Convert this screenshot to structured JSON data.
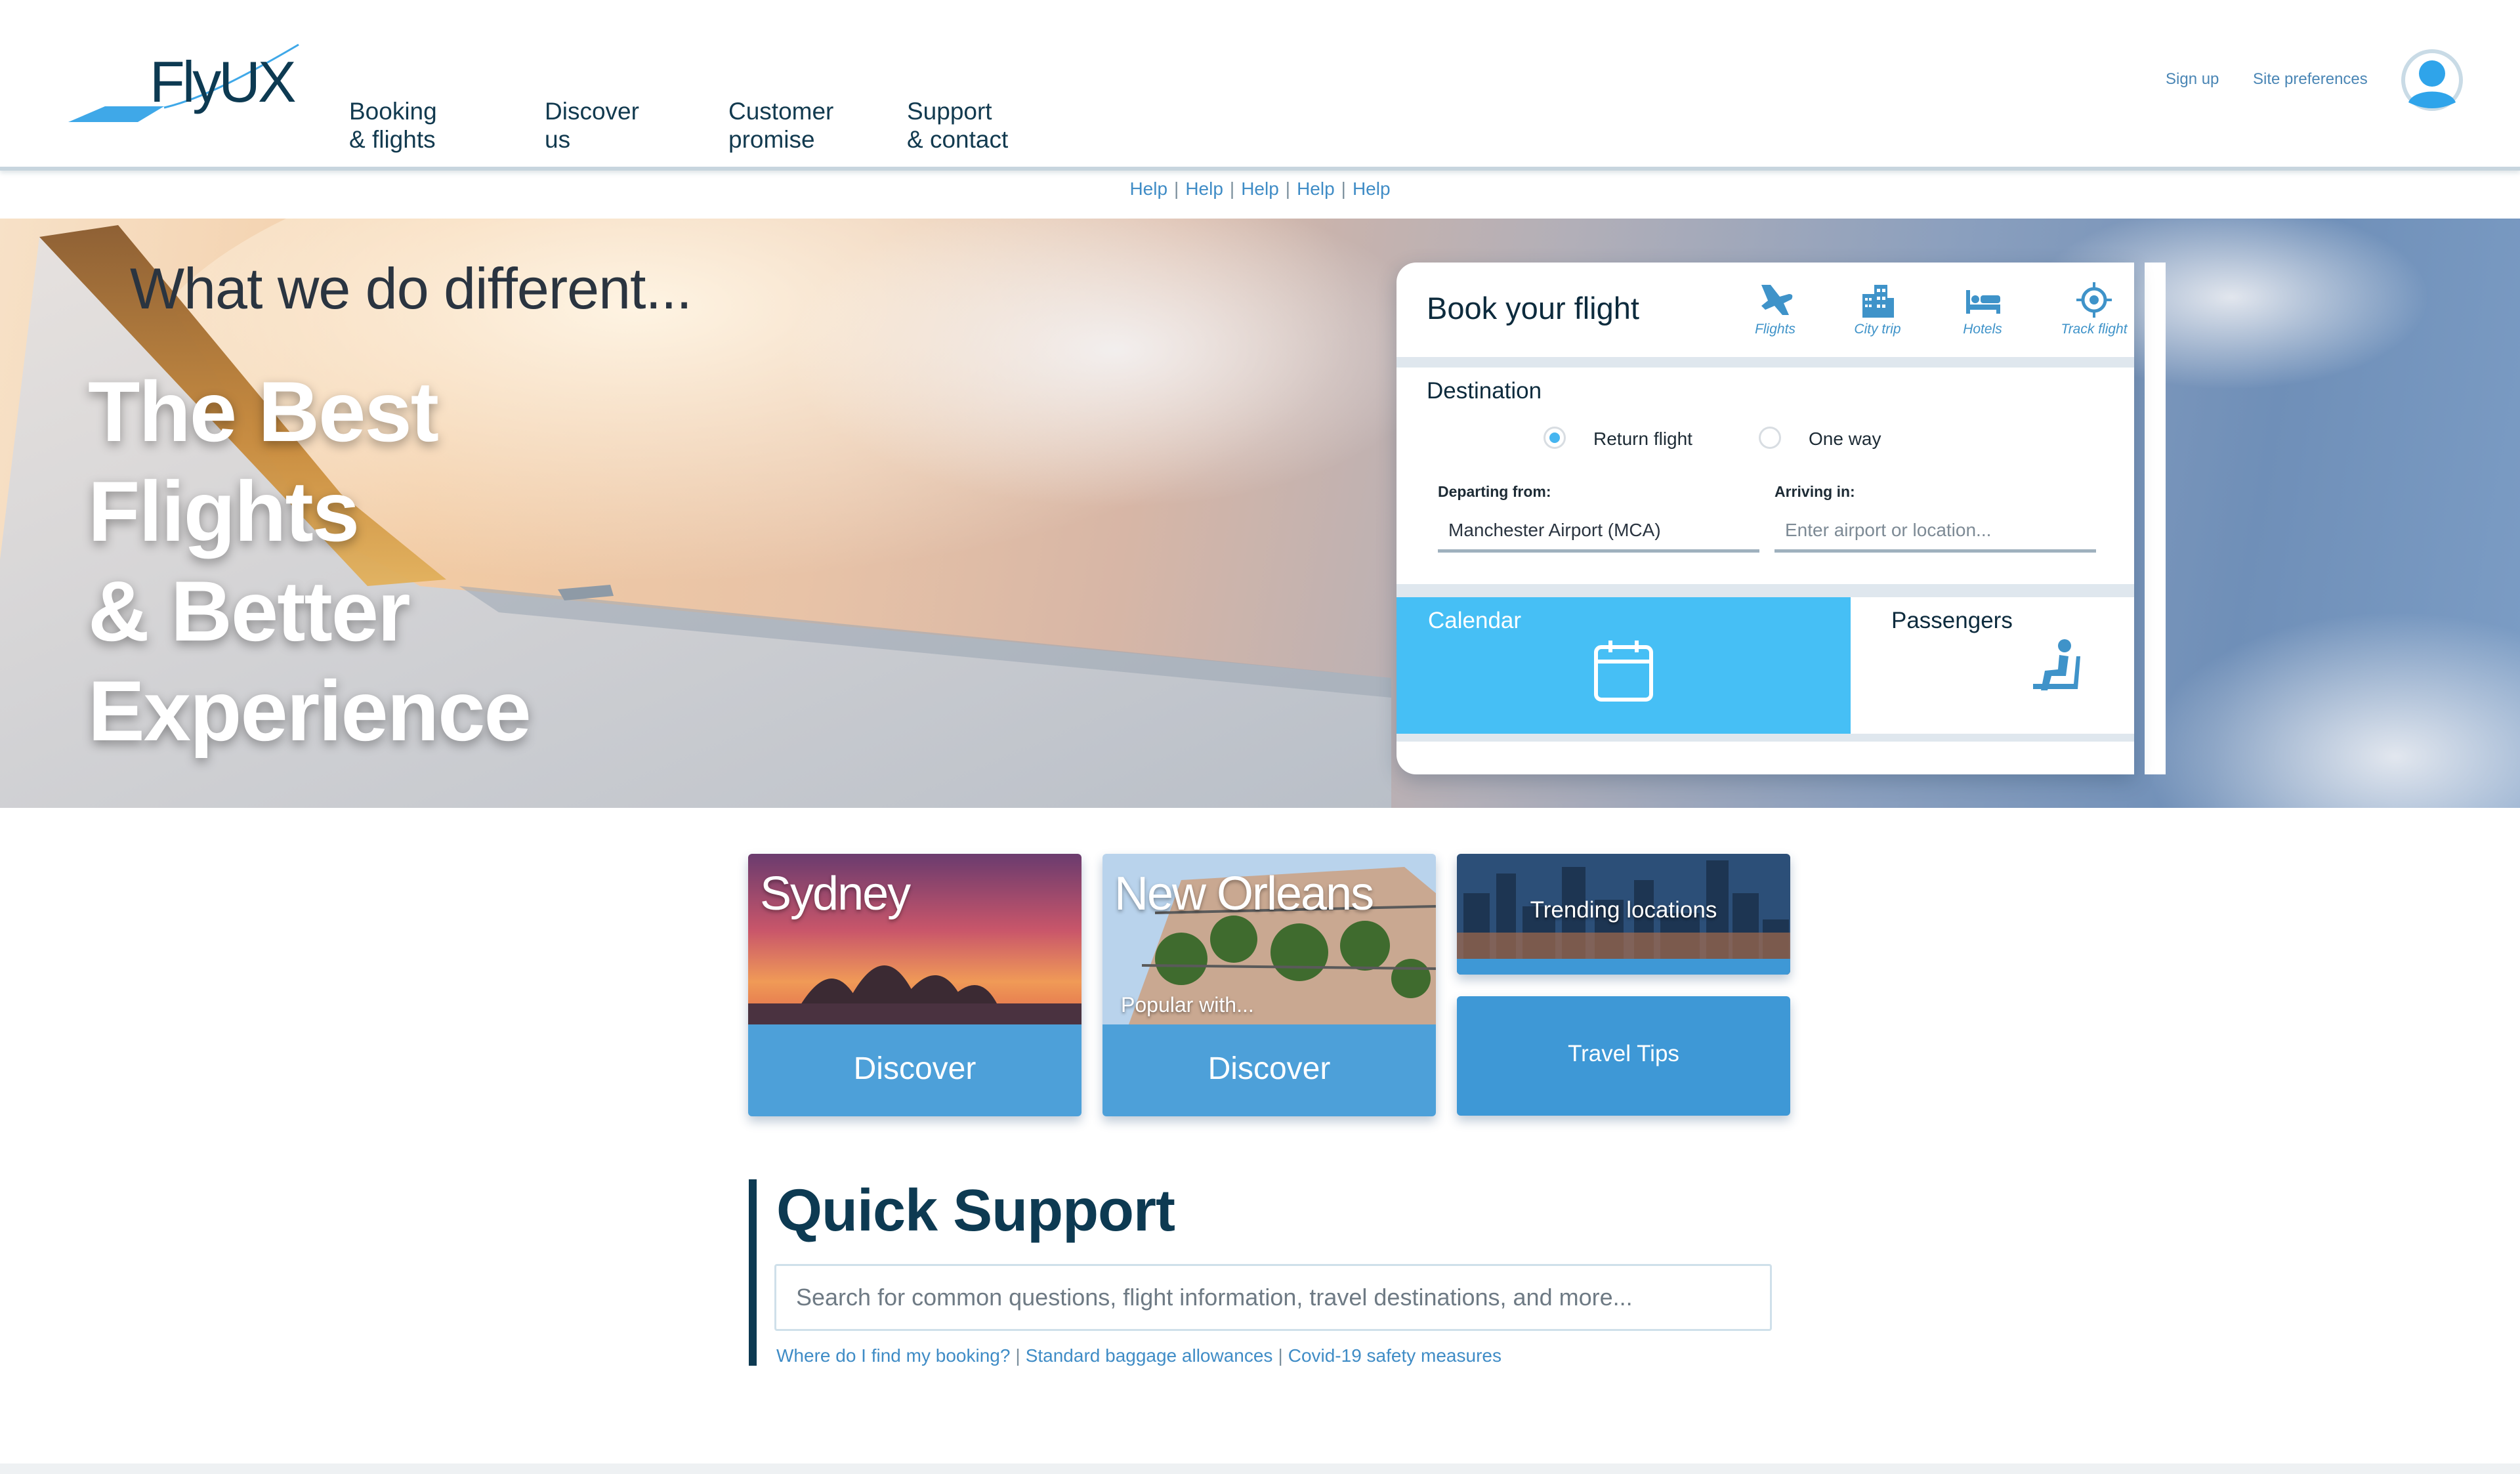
{
  "brand": {
    "logo_text": "FlyUX"
  },
  "nav": {
    "items": [
      {
        "line1": "Booking",
        "line2": "& flights"
      },
      {
        "line1": "Discover",
        "line2": "us"
      },
      {
        "line1": "Customer",
        "line2": "promise"
      },
      {
        "line1": "Support",
        "line2": "& contact"
      }
    ]
  },
  "account": {
    "sign_up": "Sign up",
    "preferences": "Site preferences",
    "avatar_icon": "user-avatar-icon"
  },
  "help_bar": {
    "links": [
      "Help",
      "Help",
      "Help",
      "Help",
      "Help"
    ],
    "separator": "|"
  },
  "hero": {
    "tagline": "What we do different...",
    "title_lines": [
      "The Best",
      "Flights",
      "& Better",
      "Experience"
    ]
  },
  "booking": {
    "title": "Book your flight",
    "tabs": [
      {
        "label": "Flights",
        "icon": "plane-icon"
      },
      {
        "label": "City trip",
        "icon": "city-icon"
      },
      {
        "label": "Hotels",
        "icon": "bed-icon"
      },
      {
        "label": "Track flight",
        "icon": "target-icon"
      }
    ],
    "destination_label": "Destination",
    "trip_type": {
      "return": "Return flight",
      "one_way": "One way",
      "selected": "return"
    },
    "departing_label": "Departing from:",
    "departing_value": "Manchester Airport (MCA)",
    "arriving_label": "Arriving in:",
    "arriving_placeholder": "Enter airport or location...",
    "calendar_label": "Calendar",
    "passengers_label": "Passengers"
  },
  "cards": {
    "sydney": {
      "city": "Sydney",
      "action": "Discover"
    },
    "new_orleans": {
      "city": "New Orleans",
      "subtitle": "Popular with...",
      "action": "Discover"
    },
    "trending": {
      "label": "Trending locations"
    },
    "travel_tips": {
      "label": "Travel Tips"
    }
  },
  "quick_support": {
    "title": "Quick Support",
    "search_placeholder": "Search for common questions, flight information, travel destinations, and more...",
    "links": [
      "Where do I find my booking?",
      "Standard baggage allowances",
      "Covid-19 safety measures"
    ],
    "separator": "|"
  },
  "colors": {
    "accent": "#46bff5",
    "brand_dark": "#0d3a52",
    "link": "#3f8cc6",
    "card_band": "#3e98d6"
  }
}
